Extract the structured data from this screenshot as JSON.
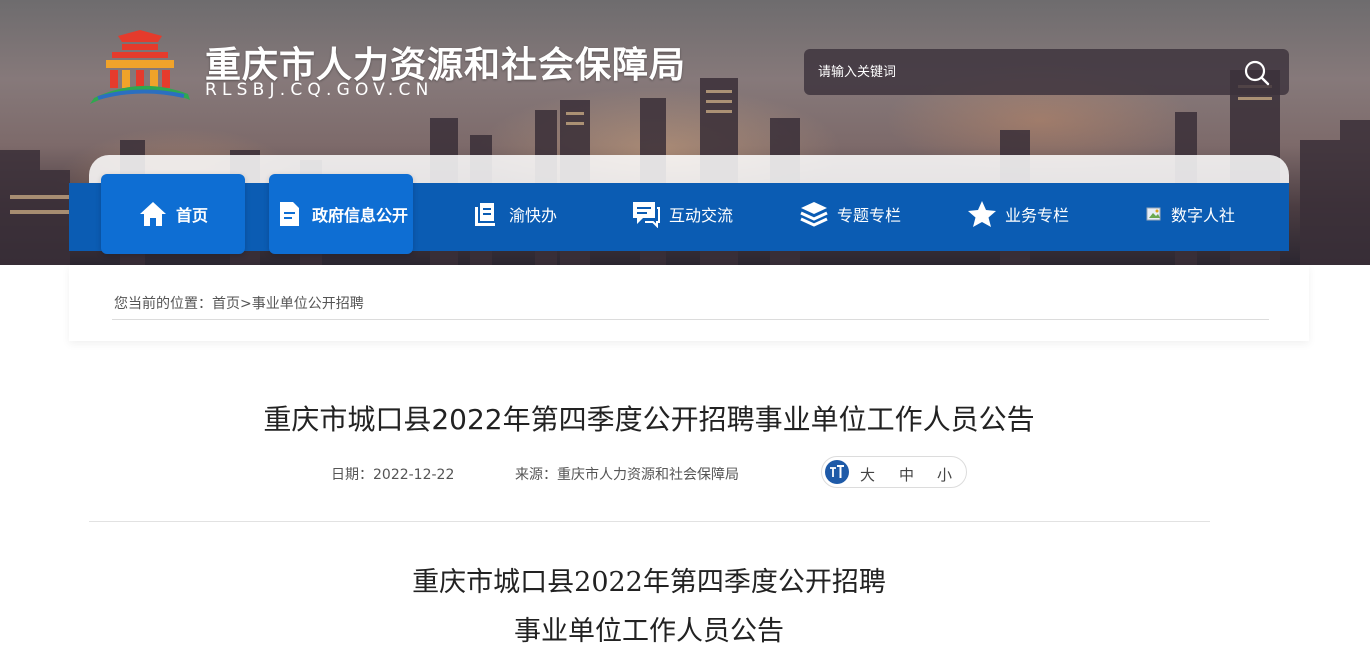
{
  "header": {
    "site_title": "重庆市人力资源和社会保障局",
    "site_domain": "RLSBJ.CQ.GOV.CN",
    "search": {
      "placeholder": "请输入关键词"
    }
  },
  "nav": {
    "items": [
      {
        "label": "首页",
        "icon": "home-icon",
        "active": true
      },
      {
        "label": "政府信息公开",
        "icon": "document-icon",
        "active": true
      },
      {
        "label": "渝快办",
        "icon": "book-icon",
        "active": false
      },
      {
        "label": "互动交流",
        "icon": "chat-icon",
        "active": false
      },
      {
        "label": "专题专栏",
        "icon": "layers-icon",
        "active": false
      },
      {
        "label": "业务专栏",
        "icon": "star-icon",
        "active": false
      },
      {
        "label": "数字人社",
        "icon": "broken-image-icon",
        "active": false
      }
    ]
  },
  "breadcrumb": {
    "prefix": "您当前的位置：",
    "home": "首页",
    "separator": ">",
    "current": "事业单位公开招聘"
  },
  "article": {
    "title": "重庆市城口县2022年第四季度公开招聘事业单位工作人员公告",
    "date_label": "日期：",
    "date": "2022-12-22",
    "source_label": "来源：",
    "source": "重庆市人力资源和社会保障局",
    "font_sizes": [
      "大",
      "中",
      "小"
    ],
    "body_title_line1": "重庆市城口县2022年第四季度公开招聘",
    "body_title_line2": "事业单位工作人员公告"
  },
  "colors": {
    "nav_bg": "#0b5cb3",
    "nav_active": "#0e6ed3",
    "font_icon_bg": "#1e5aa8"
  }
}
